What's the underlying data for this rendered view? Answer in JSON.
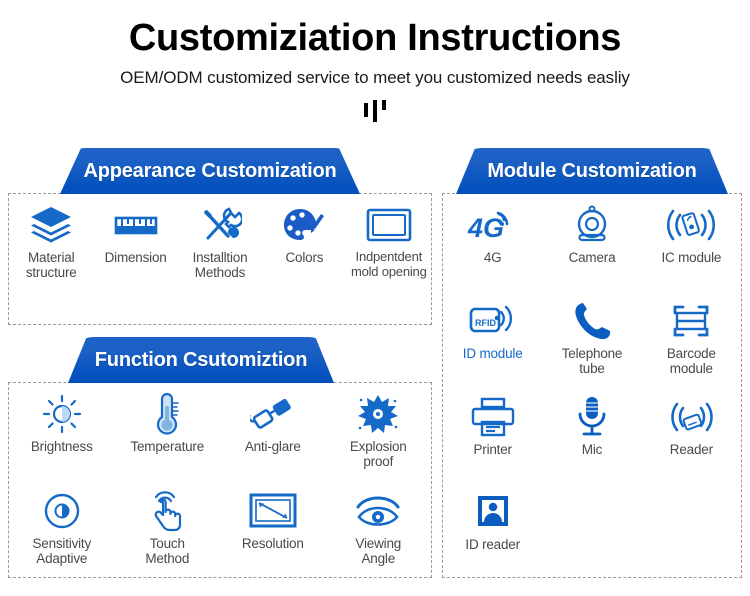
{
  "header": {
    "title": "Customiziation Instructions",
    "subtitle": "OEM/ODM customized service to meet you customized needs easliy",
    "divider": "three-vertical-bars"
  },
  "colors": {
    "banner_top": "#1f63c8",
    "banner_bottom": "#0050bb",
    "icon_blue": "#1569c7",
    "icon_blue_dark": "#0b5ec0",
    "label_gray": "#4a4a4a",
    "dash_border": "#9a9a9a",
    "title_black": "#000000"
  },
  "panels": [
    {
      "id": "appearance",
      "banner_label": "Appearance Customization",
      "columns": 5,
      "items": [
        {
          "label": "Material\nstructure",
          "icon": "layers-icon",
          "accent": false
        },
        {
          "label": "Dimension",
          "icon": "ruler-icon",
          "accent": false
        },
        {
          "label": "Installtion\nMethods",
          "icon": "tools-icon",
          "accent": false
        },
        {
          "label": "Colors",
          "icon": "palette-icon",
          "accent": false
        },
        {
          "label": "Indpentdent\nmold opening",
          "icon": "mold-frame-icon",
          "accent": false
        }
      ]
    },
    {
      "id": "function",
      "banner_label": "Function Csutomiztion",
      "columns": 4,
      "items": [
        {
          "label": "Brightness",
          "icon": "brightness-sun-icon",
          "accent": false
        },
        {
          "label": "Temperature",
          "icon": "thermometer-icon",
          "accent": false
        },
        {
          "label": "Anti-glare",
          "icon": "glasses-icon",
          "accent": false
        },
        {
          "label": "Explosion\nproof",
          "icon": "explosion-proof-icon",
          "accent": false
        },
        {
          "label": "Sensitivity\nAdaptive",
          "icon": "sensitivity-circle-icon",
          "accent": false
        },
        {
          "label": "Touch\nMethod",
          "icon": "touch-hand-icon",
          "accent": false
        },
        {
          "label": "Resolution",
          "icon": "resolution-screen-icon",
          "accent": false
        },
        {
          "label": "Viewing\nAngle",
          "icon": "eye-icon",
          "accent": false
        }
      ]
    },
    {
      "id": "module",
      "banner_label": "Module Customization",
      "columns": 3,
      "items": [
        {
          "label": "4G",
          "icon": "4g-signal-icon",
          "accent": false
        },
        {
          "label": "Camera",
          "icon": "camera-icon",
          "accent": false
        },
        {
          "label": "IC module",
          "icon": "ic-module-icon",
          "accent": false
        },
        {
          "label": "ID module",
          "icon": "rfid-card-icon",
          "accent": true
        },
        {
          "label": "Telephone\ntube",
          "icon": "telephone-handset-icon",
          "accent": false
        },
        {
          "label": "Barcode\nmodule",
          "icon": "barcode-scanner-icon",
          "accent": false
        },
        {
          "label": "Printer",
          "icon": "printer-icon",
          "accent": false
        },
        {
          "label": "Mic",
          "icon": "microphone-icon",
          "accent": false
        },
        {
          "label": "Reader",
          "icon": "card-reader-icon",
          "accent": false
        },
        {
          "label": "ID reader",
          "icon": "id-photo-icon",
          "accent": false
        }
      ]
    }
  ]
}
